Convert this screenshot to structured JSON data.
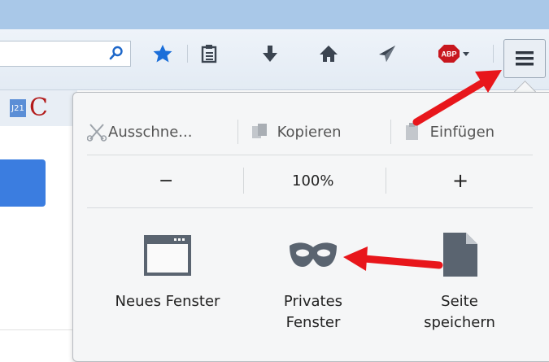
{
  "edit": {
    "cut_label": "Ausschne...",
    "copy_label": "Kopieren",
    "paste_label": "Einfügen"
  },
  "zoom": {
    "minus_label": "−",
    "level": "100%",
    "plus_label": "+"
  },
  "actions": {
    "new_window_label": "Neues Fenster",
    "private_window_line1": "Privates",
    "private_window_line2": "Fenster",
    "save_page_line1": "Seite",
    "save_page_line2": "speichern"
  },
  "bookmarks": {
    "j21_label": "J21",
    "c_label": "C"
  },
  "toolbar": {
    "abp_label": "ABP"
  },
  "colors": {
    "arrow": "#e8161b",
    "accent_blue": "#3b7de0",
    "star_blue": "#1b6ed9",
    "icon_gray": "#5a6470"
  }
}
